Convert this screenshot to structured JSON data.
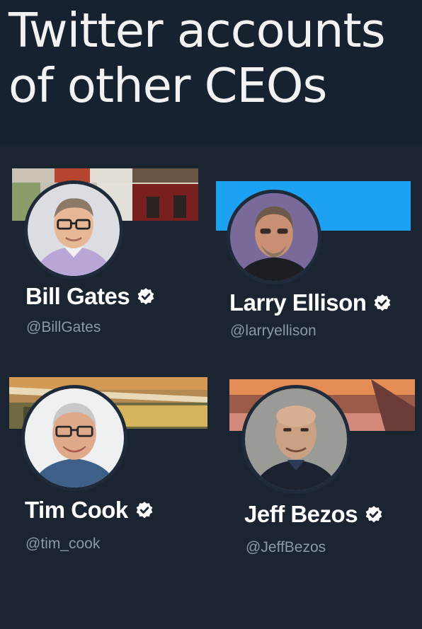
{
  "header": {
    "title_line1": "Twitter accounts",
    "title_line2": "of other CEOs"
  },
  "accounts": [
    {
      "name": "Bill Gates",
      "handle": "@BillGates",
      "verified": true,
      "avatar_icon": "bill-gates-avatar",
      "banner": "photo-collage"
    },
    {
      "name": "Larry Ellison",
      "handle": "@larryellison",
      "verified": true,
      "avatar_icon": "larry-ellison-avatar",
      "banner": "solid-blue"
    },
    {
      "name": "Tim Cook",
      "handle": "@tim_cook",
      "verified": true,
      "avatar_icon": "tim-cook-avatar",
      "banner": "building-photo"
    },
    {
      "name": "Jeff Bezos",
      "handle": "@JeffBezos",
      "verified": true,
      "avatar_icon": "jeff-bezos-avatar",
      "banner": "sunset-photo"
    }
  ],
  "colors": {
    "background": "#1b2532",
    "header_background": "#172230",
    "handle_gray": "#8b98a5",
    "twitter_blue": "#1da1f2",
    "verified_badge": "#ffffff"
  }
}
